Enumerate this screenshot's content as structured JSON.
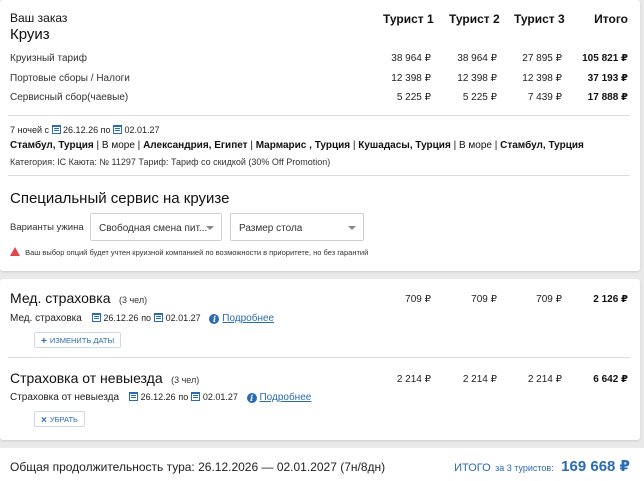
{
  "order": {
    "title": "Ваш заказ",
    "subtitle": "Круиз",
    "columns": [
      "Турист 1",
      "Турист 2",
      "Турист 3",
      "Итого"
    ],
    "rows": [
      {
        "label": "Круизный тариф",
        "values": [
          "38 964 ₽",
          "38 964 ₽",
          "27 895 ₽",
          "105 821 ₽"
        ]
      },
      {
        "label": "Портовые сборы / Налоги",
        "values": [
          "12 398 ₽",
          "12 398 ₽",
          "12 398 ₽",
          "37 193 ₽"
        ]
      },
      {
        "label": "Сервисный сбор(чаевые)",
        "values": [
          "5 225 ₽",
          "5 225 ₽",
          "7 439 ₽",
          "17 888 ₽"
        ]
      }
    ]
  },
  "cruise": {
    "nights_text": "7 ночей с",
    "date_from": "26.12.26",
    "by": "по",
    "date_to": "02.01.27",
    "route": [
      {
        "text": "Стамбул, Турция",
        "bold": true
      },
      {
        "text": " | ",
        "bold": false
      },
      {
        "text": "В море",
        "bold": false
      },
      {
        "text": " | ",
        "bold": false
      },
      {
        "text": "Александрия, Египет",
        "bold": true
      },
      {
        "text": " | ",
        "bold": false
      },
      {
        "text": "Мармарис , Турция",
        "bold": true
      },
      {
        "text": " | ",
        "bold": false
      },
      {
        "text": "Кушадасы, Турция",
        "bold": true
      },
      {
        "text": " | ",
        "bold": false
      },
      {
        "text": "В море",
        "bold": false
      },
      {
        "text": " | ",
        "bold": false
      },
      {
        "text": "Стамбул, Турция",
        "bold": true
      }
    ],
    "details": "Категория: IC  Каюта: № 11297  Тариф: Тариф со скидкой (30% Off Promotion)"
  },
  "special_service": {
    "title": "Специальный сервис на круизе",
    "dinner_label": "Варианты ужина",
    "dinner_value": "Свободная смена пит...",
    "table_size_value": "Размер стола",
    "warning": "Ваш выбор опций будет учтен круизной компанией по возможности в приоритете, но без гарантий"
  },
  "medical": {
    "title": "Мед. страховка",
    "count": "(3 чел)",
    "values": [
      "709 ₽",
      "709 ₽",
      "709 ₽",
      "2 126 ₽"
    ],
    "sub_label": "Мед. страховка",
    "date_from": "26.12.26",
    "by": "по",
    "date_to": "02.01.27",
    "more_link": "Подробнее",
    "change_button": "ИЗМЕНИТЬ ДАТЫ"
  },
  "cancellation": {
    "title": "Страховка от невыезда",
    "count": "(3 чел)",
    "values": [
      "2 214 ₽",
      "2 214 ₽",
      "2 214 ₽",
      "6 642 ₽"
    ],
    "sub_label": "Страховка от невыезда",
    "date_from": "26.12.26",
    "by": "по",
    "date_to": "02.01.27",
    "more_link": "Подробнее",
    "remove_button": "УБРАТЬ"
  },
  "footer": {
    "duration_text": "Общая продолжительность тура: 26.12.2026 — 02.01.2027 (7н/8дн)",
    "total_label": "ИТОГО",
    "total_for": "за 3 туристов:",
    "total_value": "169 668 ₽"
  },
  "colors": {
    "accent": "#2b6bb3",
    "warning": "#e04848"
  }
}
